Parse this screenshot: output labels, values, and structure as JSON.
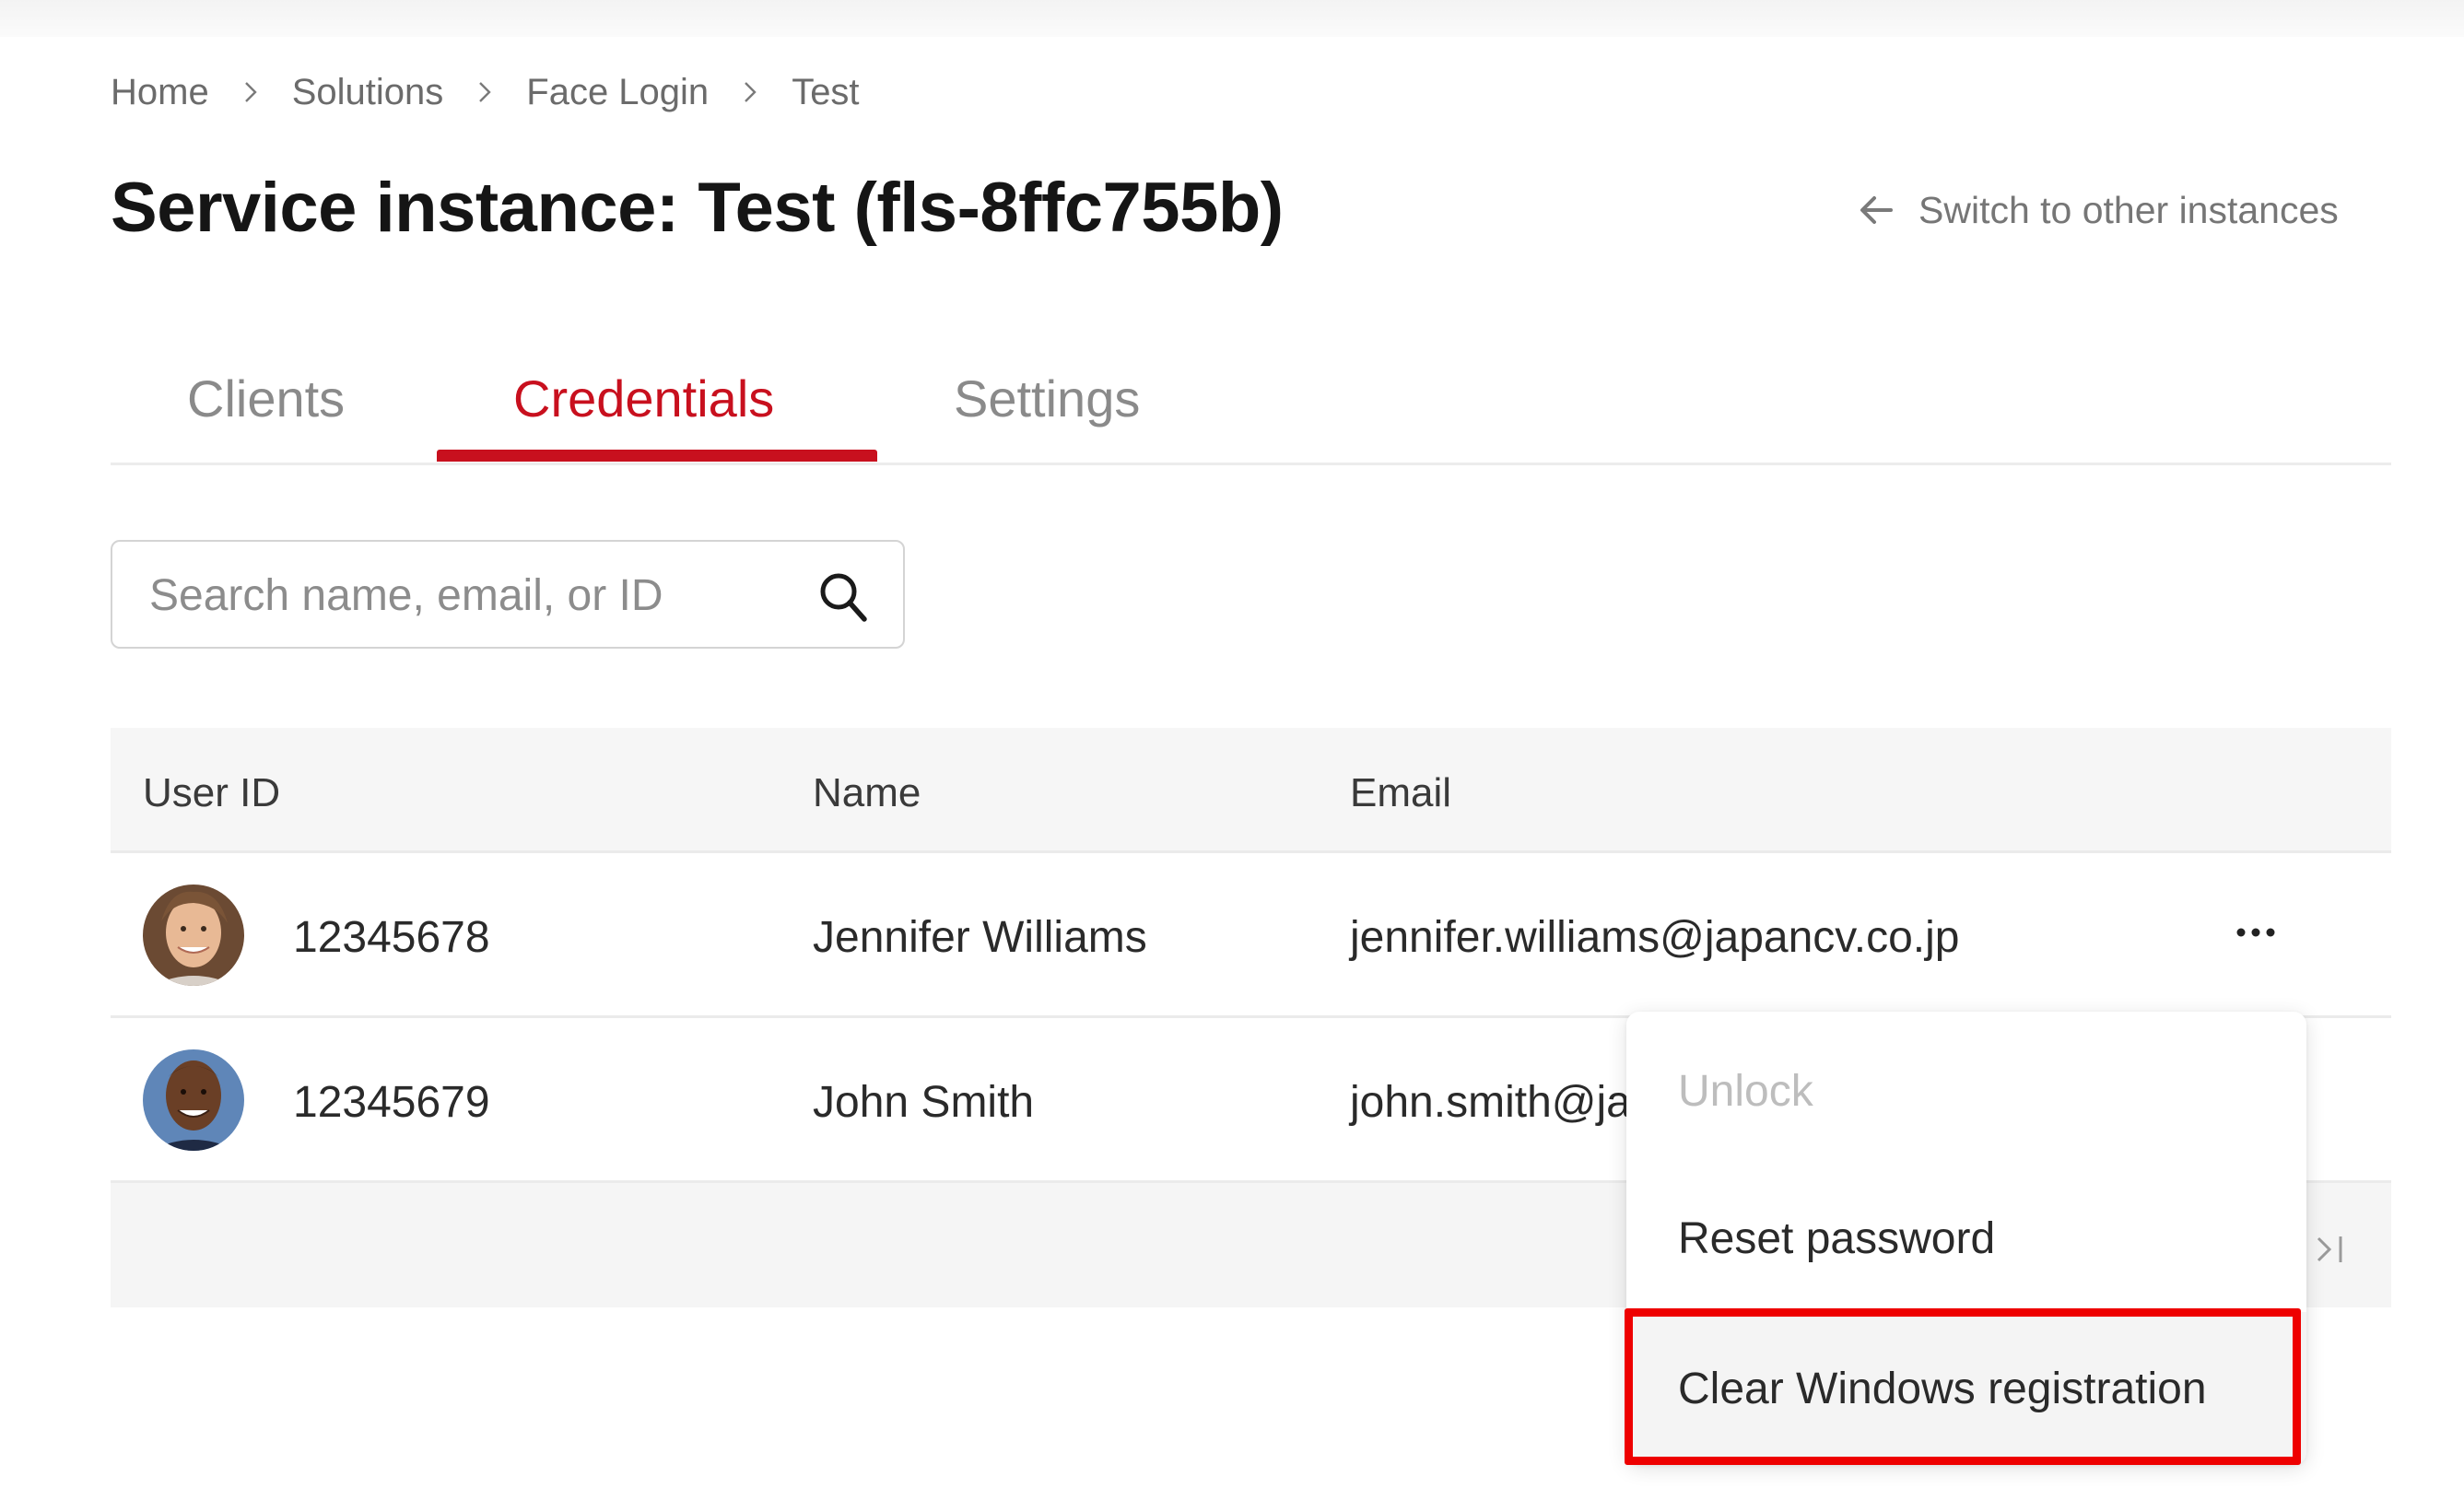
{
  "breadcrumb": {
    "items": [
      "Home",
      "Solutions",
      "Face Login",
      "Test"
    ]
  },
  "header": {
    "title": "Service instance: Test (fls-8ffc755b)",
    "switch_link": "Switch to other instances"
  },
  "tabs": [
    {
      "label": "Clients",
      "active": false
    },
    {
      "label": "Credentials",
      "active": true
    },
    {
      "label": "Settings",
      "active": false
    }
  ],
  "search": {
    "placeholder": "Search name, email, or ID",
    "value": ""
  },
  "table": {
    "columns": [
      "User ID",
      "Name",
      "Email"
    ],
    "rows": [
      {
        "user_id": "12345678",
        "name": "Jennifer Williams",
        "email": "jennifer.williams@japancv.co.jp"
      },
      {
        "user_id": "12345679",
        "name": "John Smith",
        "email": "john.smith@japancv.co.jp"
      }
    ]
  },
  "row_menu": {
    "items": [
      {
        "label": "Unlock",
        "disabled": true
      },
      {
        "label": "Reset password",
        "disabled": false
      },
      {
        "label": "Clear Windows registration",
        "disabled": false,
        "highlighted": true
      }
    ]
  },
  "colors": {
    "accent": "#c8101e",
    "annotation_highlight": "#ee0000",
    "header_bg": "#f6f6f6",
    "muted_text": "#8a8a8a"
  }
}
